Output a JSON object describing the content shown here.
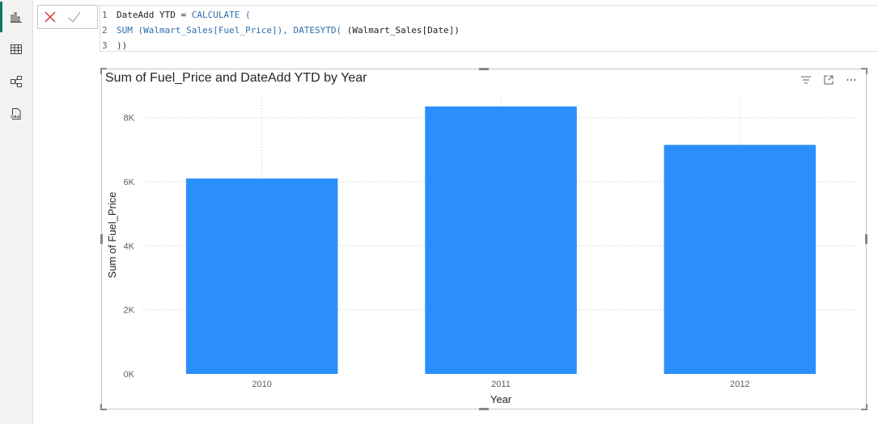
{
  "rail": {
    "items": [
      {
        "name": "report-view",
        "icon": "bar-chart-icon",
        "active": true
      },
      {
        "name": "table-view",
        "icon": "table-grid-icon",
        "active": false
      },
      {
        "name": "model-view",
        "icon": "model-diagram-icon",
        "active": false
      },
      {
        "name": "dax-query-view",
        "icon": "dax-query-icon",
        "active": false
      }
    ]
  },
  "formula_bar": {
    "lines": [
      {
        "num": "1",
        "parts": [
          {
            "text": "DateAdd YTD = ",
            "style": "tx"
          },
          {
            "text": "CALCULATE (",
            "style": "kw"
          }
        ]
      },
      {
        "num": "2",
        "parts": [
          {
            "text": "SUM (Walmart_Sales[Fuel_Price]), DATESYTD( ",
            "style": "kw"
          },
          {
            "text": "(Walmart_Sales[Date])",
            "style": "tx"
          }
        ]
      },
      {
        "num": "3",
        "parts": [
          {
            "text": "))",
            "style": "br"
          }
        ]
      }
    ]
  },
  "visual": {
    "title": "Sum of Fuel_Price and DateAdd YTD by Year",
    "header_icons": [
      "filter-icon",
      "focus-mode-icon",
      "more-options-icon"
    ]
  },
  "chart_data": {
    "type": "bar",
    "title": "Sum of Fuel_Price and DateAdd YTD by Year",
    "xlabel": "Year",
    "ylabel": "Sum of Fuel_Price",
    "categories": [
      "2010",
      "2011",
      "2012"
    ],
    "values": [
      6100,
      8350,
      7150
    ],
    "ylim": [
      0,
      9000
    ],
    "yticks": [
      0,
      2000,
      4000,
      6000,
      8000
    ],
    "ytick_labels": [
      "0K",
      "2K",
      "4K",
      "6K",
      "8K"
    ],
    "grid": true,
    "bar_color": "#2b8ffb",
    "grid_color": "#c8c6c4"
  }
}
